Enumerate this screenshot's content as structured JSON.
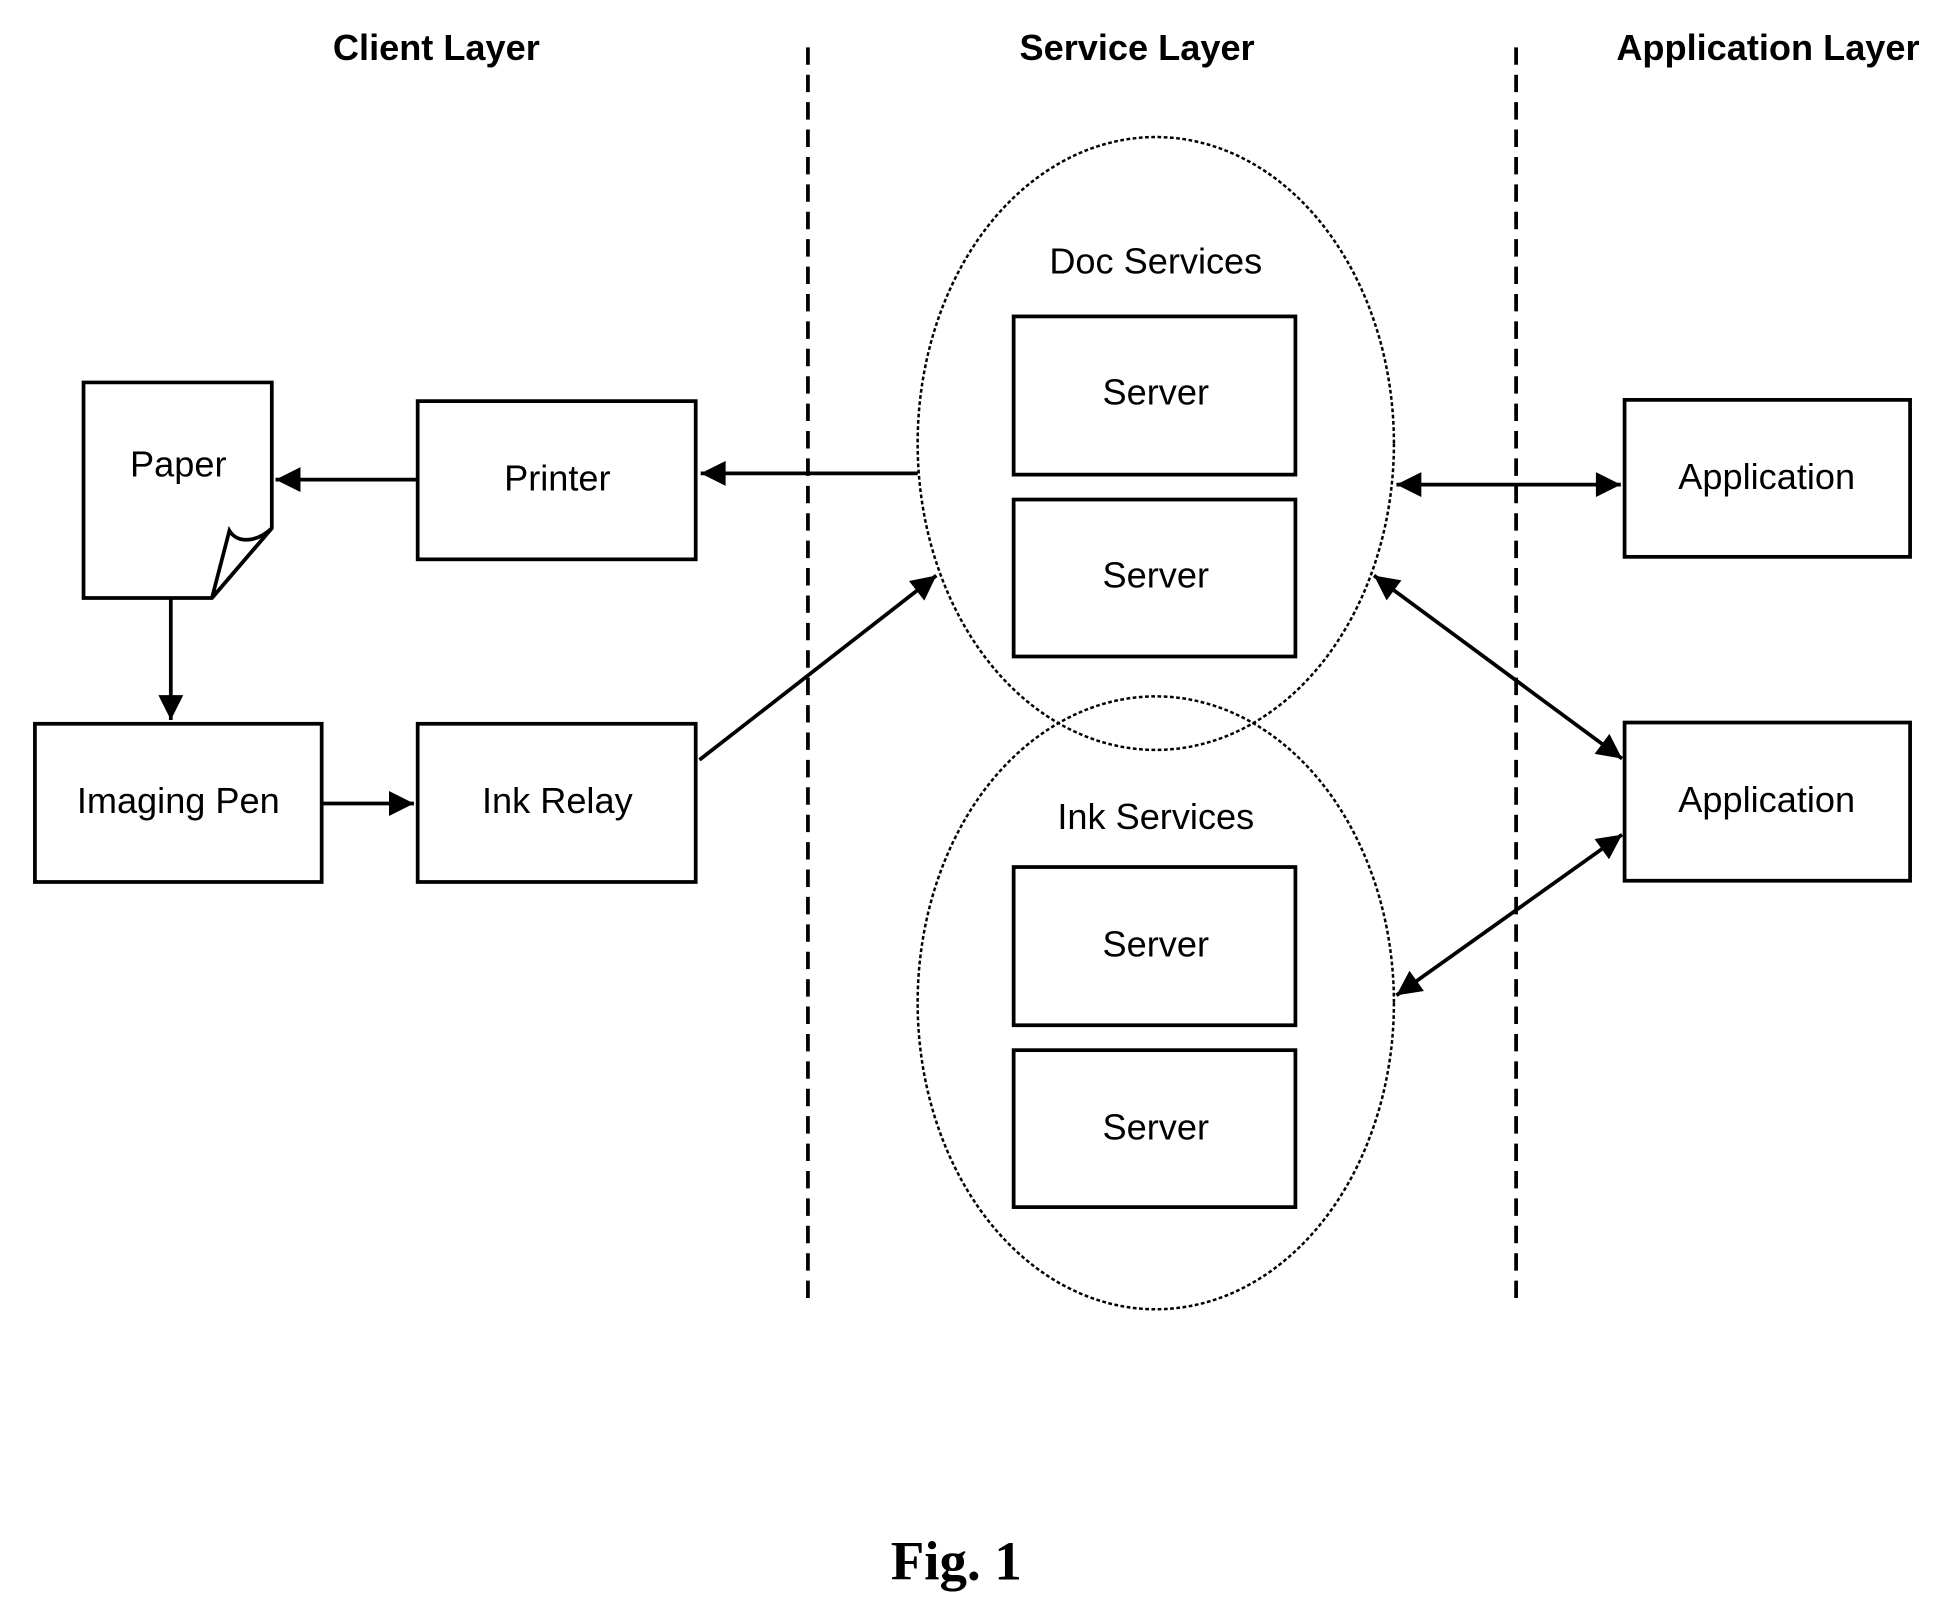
{
  "layers": {
    "client": "Client Layer",
    "service": "Service Layer",
    "application": "Application Layer"
  },
  "client_nodes": {
    "paper": "Paper",
    "printer": "Printer",
    "imaging_pen": "Imaging Pen",
    "ink_relay": "Ink Relay"
  },
  "service_groups": {
    "doc": {
      "title": "Doc Services",
      "servers": [
        "Server",
        "Server"
      ]
    },
    "ink": {
      "title": "Ink Services",
      "servers": [
        "Server",
        "Server"
      ]
    }
  },
  "applications": [
    "Application",
    "Application"
  ],
  "edges": [
    {
      "from": "Doc Services",
      "to": "Printer",
      "direction": "one-way"
    },
    {
      "from": "Printer",
      "to": "Paper",
      "direction": "one-way"
    },
    {
      "from": "Paper",
      "to": "Imaging Pen",
      "direction": "one-way"
    },
    {
      "from": "Imaging Pen",
      "to": "Ink Relay",
      "direction": "one-way"
    },
    {
      "from": "Ink Relay",
      "to": "Doc Services",
      "direction": "one-way"
    },
    {
      "from": "Doc Services",
      "to": "Application 1",
      "direction": "two-way"
    },
    {
      "from": "Doc Services",
      "to": "Application 2",
      "direction": "two-way"
    },
    {
      "from": "Ink Services",
      "to": "Application 2",
      "direction": "two-way"
    }
  ],
  "caption": "Fig. 1"
}
